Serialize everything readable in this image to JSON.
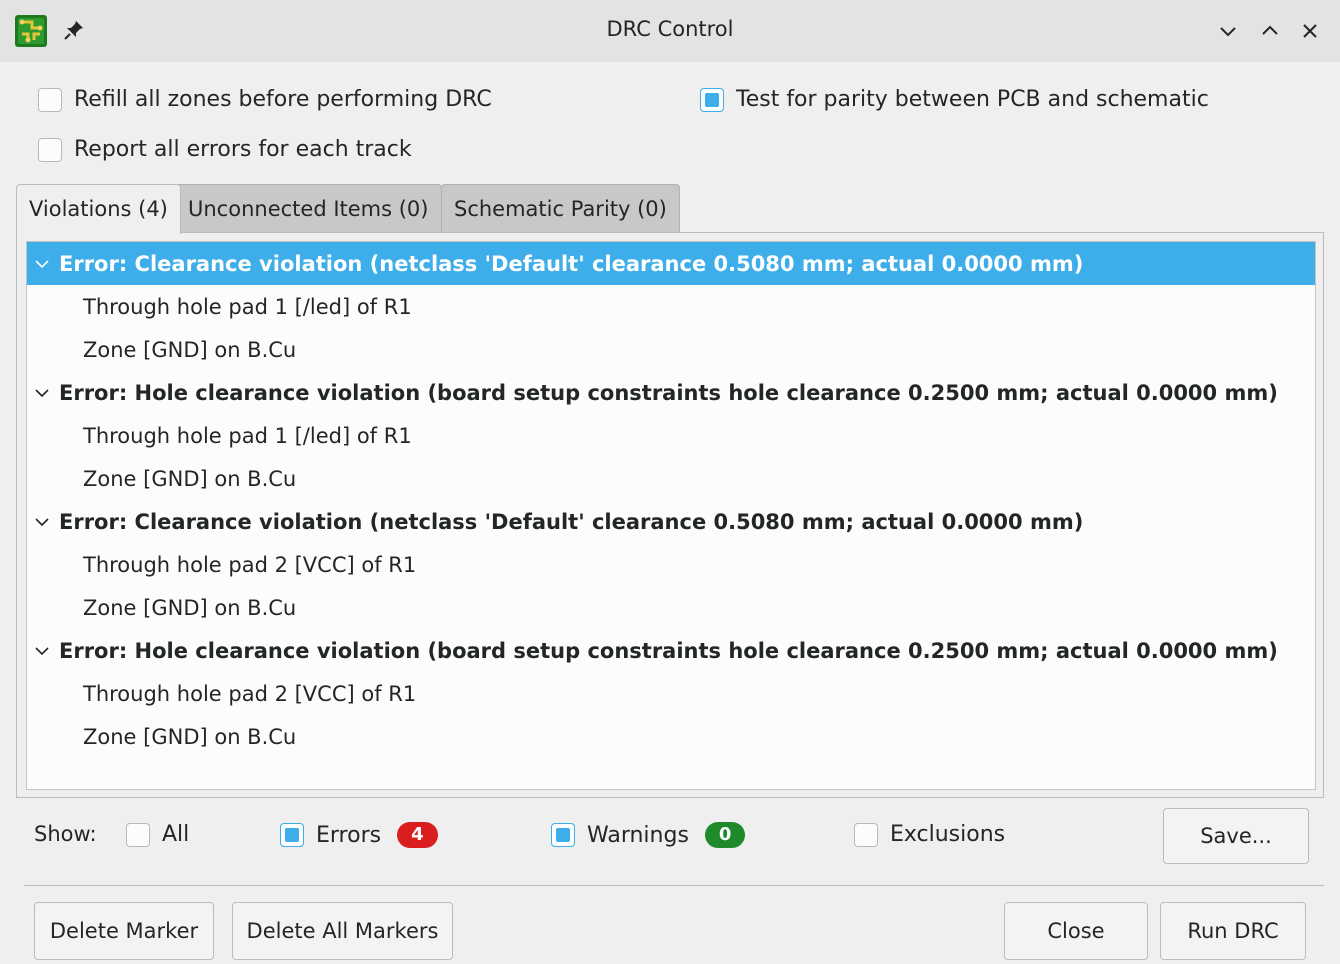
{
  "window": {
    "title": "DRC Control"
  },
  "options": {
    "refill_zones": {
      "label": "Refill all zones before performing DRC",
      "checked": false
    },
    "test_parity": {
      "label": "Test for parity between PCB and schematic",
      "checked": true
    },
    "report_all": {
      "label": "Report all errors for each track",
      "checked": false
    }
  },
  "tabs": [
    {
      "label": "Violations (4)",
      "active": true
    },
    {
      "label": "Unconnected Items (0)",
      "active": false
    },
    {
      "label": "Schematic Parity (0)",
      "active": false
    }
  ],
  "violations": [
    {
      "title": "Error: Clearance violation (netclass 'Default' clearance 0.5080 mm; actual 0.0000 mm)",
      "items": [
        "Through hole pad 1 [/led] of R1",
        "Zone [GND] on B.Cu"
      ],
      "selected": true
    },
    {
      "title": "Error: Hole clearance violation (board setup constraints hole clearance 0.2500 mm; actual 0.0000 mm)",
      "items": [
        "Through hole pad 1 [/led] of R1",
        "Zone [GND] on B.Cu"
      ],
      "selected": false
    },
    {
      "title": "Error: Clearance violation (netclass 'Default' clearance 0.5080 mm; actual 0.0000 mm)",
      "items": [
        "Through hole pad 2 [VCC] of R1",
        "Zone [GND] on B.Cu"
      ],
      "selected": false
    },
    {
      "title": "Error: Hole clearance violation (board setup constraints hole clearance 0.2500 mm; actual 0.0000 mm)",
      "items": [
        "Through hole pad 2 [VCC] of R1",
        "Zone [GND] on B.Cu"
      ],
      "selected": false
    }
  ],
  "filters": {
    "show_label": "Show:",
    "all": {
      "label": "All",
      "checked": false
    },
    "errors": {
      "label": "Errors",
      "checked": true,
      "count": "4",
      "color": "#da1e1e"
    },
    "warnings": {
      "label": "Warnings",
      "checked": true,
      "count": "0",
      "color": "#1e8a2a"
    },
    "exclusions": {
      "label": "Exclusions",
      "checked": false
    }
  },
  "buttons": {
    "save": "Save...",
    "delete_marker": "Delete Marker",
    "delete_all_markers": "Delete All Markers",
    "close": "Close",
    "run_drc": "Run DRC"
  },
  "colors": {
    "accent": "#3daee9"
  },
  "icons": [
    "kicad-pcb-icon",
    "pin-icon",
    "minimize-icon",
    "maximize-icon",
    "close-icon",
    "chevron-down-icon"
  ]
}
